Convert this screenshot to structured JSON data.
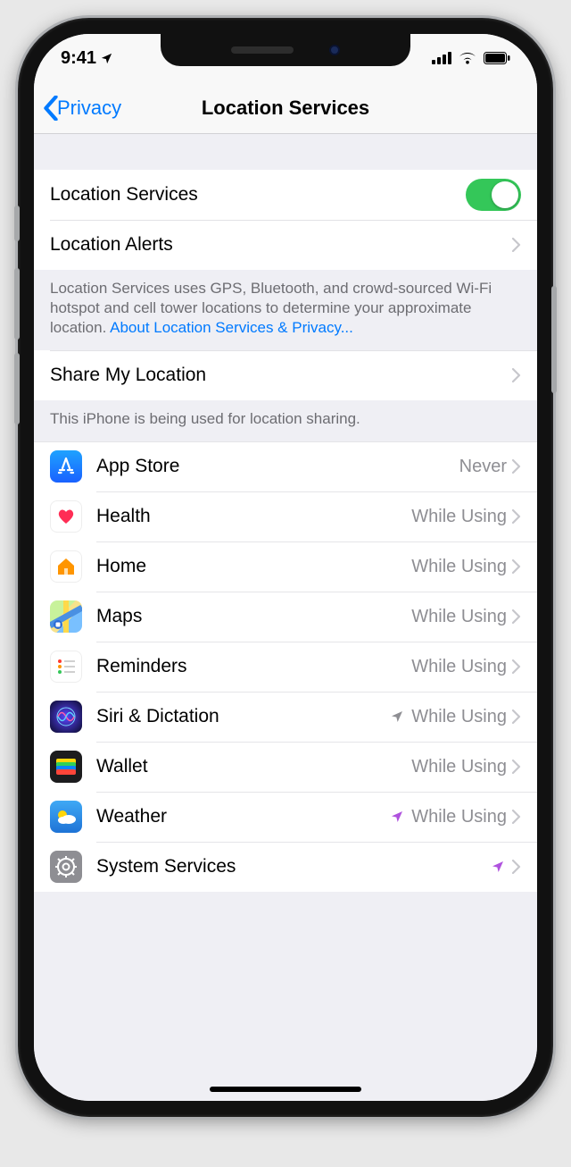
{
  "status": {
    "time": "9:41"
  },
  "nav": {
    "back": "Privacy",
    "title": "Location Services"
  },
  "main": {
    "location_services_label": "Location Services",
    "location_alerts_label": "Location Alerts"
  },
  "footer1": {
    "text": "Location Services uses GPS, Bluetooth, and crowd-sourced Wi-Fi hotspot and cell tower locations to determine your approximate location.",
    "link": "About Location Services & Privacy..."
  },
  "share": {
    "label": "Share My Location"
  },
  "footer2": {
    "text": "This iPhone is being used for location sharing."
  },
  "apps": [
    {
      "name": "App Store",
      "value": "Never",
      "indicator": "none",
      "icon": "appstore"
    },
    {
      "name": "Health",
      "value": "While Using",
      "indicator": "none",
      "icon": "health"
    },
    {
      "name": "Home",
      "value": "While Using",
      "indicator": "none",
      "icon": "home"
    },
    {
      "name": "Maps",
      "value": "While Using",
      "indicator": "none",
      "icon": "maps"
    },
    {
      "name": "Reminders",
      "value": "While Using",
      "indicator": "none",
      "icon": "reminders"
    },
    {
      "name": "Siri & Dictation",
      "value": "While Using",
      "indicator": "gray",
      "icon": "siri"
    },
    {
      "name": "Wallet",
      "value": "While Using",
      "indicator": "none",
      "icon": "wallet"
    },
    {
      "name": "Weather",
      "value": "While Using",
      "indicator": "purple",
      "icon": "weather"
    },
    {
      "name": "System Services",
      "value": "",
      "indicator": "purple",
      "icon": "system"
    }
  ]
}
